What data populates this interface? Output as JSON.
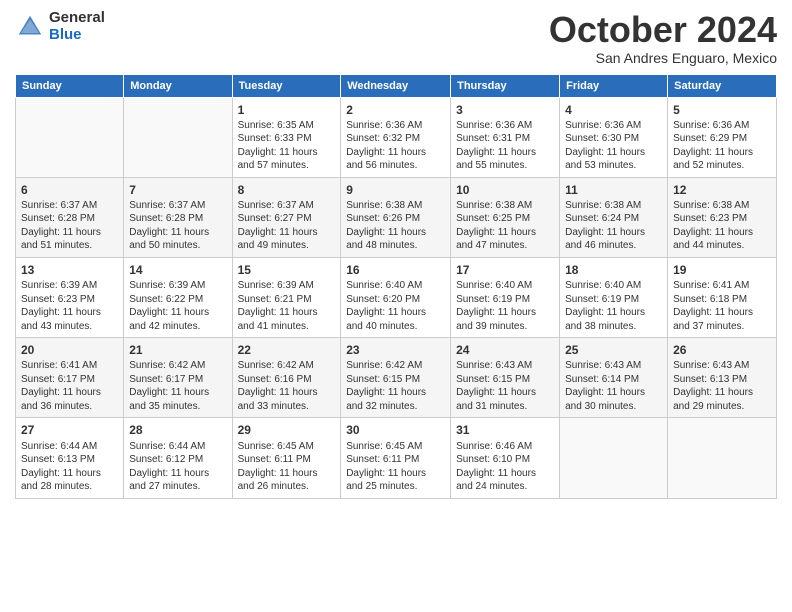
{
  "header": {
    "logo_general": "General",
    "logo_blue": "Blue",
    "month_title": "October 2024",
    "location": "San Andres Enguaro, Mexico"
  },
  "days_of_week": [
    "Sunday",
    "Monday",
    "Tuesday",
    "Wednesday",
    "Thursday",
    "Friday",
    "Saturday"
  ],
  "weeks": [
    [
      {
        "day": "",
        "info": ""
      },
      {
        "day": "",
        "info": ""
      },
      {
        "day": "1",
        "info": "Sunrise: 6:35 AM\nSunset: 6:33 PM\nDaylight: 11 hours and 57 minutes."
      },
      {
        "day": "2",
        "info": "Sunrise: 6:36 AM\nSunset: 6:32 PM\nDaylight: 11 hours and 56 minutes."
      },
      {
        "day": "3",
        "info": "Sunrise: 6:36 AM\nSunset: 6:31 PM\nDaylight: 11 hours and 55 minutes."
      },
      {
        "day": "4",
        "info": "Sunrise: 6:36 AM\nSunset: 6:30 PM\nDaylight: 11 hours and 53 minutes."
      },
      {
        "day": "5",
        "info": "Sunrise: 6:36 AM\nSunset: 6:29 PM\nDaylight: 11 hours and 52 minutes."
      }
    ],
    [
      {
        "day": "6",
        "info": "Sunrise: 6:37 AM\nSunset: 6:28 PM\nDaylight: 11 hours and 51 minutes."
      },
      {
        "day": "7",
        "info": "Sunrise: 6:37 AM\nSunset: 6:28 PM\nDaylight: 11 hours and 50 minutes."
      },
      {
        "day": "8",
        "info": "Sunrise: 6:37 AM\nSunset: 6:27 PM\nDaylight: 11 hours and 49 minutes."
      },
      {
        "day": "9",
        "info": "Sunrise: 6:38 AM\nSunset: 6:26 PM\nDaylight: 11 hours and 48 minutes."
      },
      {
        "day": "10",
        "info": "Sunrise: 6:38 AM\nSunset: 6:25 PM\nDaylight: 11 hours and 47 minutes."
      },
      {
        "day": "11",
        "info": "Sunrise: 6:38 AM\nSunset: 6:24 PM\nDaylight: 11 hours and 46 minutes."
      },
      {
        "day": "12",
        "info": "Sunrise: 6:38 AM\nSunset: 6:23 PM\nDaylight: 11 hours and 44 minutes."
      }
    ],
    [
      {
        "day": "13",
        "info": "Sunrise: 6:39 AM\nSunset: 6:23 PM\nDaylight: 11 hours and 43 minutes."
      },
      {
        "day": "14",
        "info": "Sunrise: 6:39 AM\nSunset: 6:22 PM\nDaylight: 11 hours and 42 minutes."
      },
      {
        "day": "15",
        "info": "Sunrise: 6:39 AM\nSunset: 6:21 PM\nDaylight: 11 hours and 41 minutes."
      },
      {
        "day": "16",
        "info": "Sunrise: 6:40 AM\nSunset: 6:20 PM\nDaylight: 11 hours and 40 minutes."
      },
      {
        "day": "17",
        "info": "Sunrise: 6:40 AM\nSunset: 6:19 PM\nDaylight: 11 hours and 39 minutes."
      },
      {
        "day": "18",
        "info": "Sunrise: 6:40 AM\nSunset: 6:19 PM\nDaylight: 11 hours and 38 minutes."
      },
      {
        "day": "19",
        "info": "Sunrise: 6:41 AM\nSunset: 6:18 PM\nDaylight: 11 hours and 37 minutes."
      }
    ],
    [
      {
        "day": "20",
        "info": "Sunrise: 6:41 AM\nSunset: 6:17 PM\nDaylight: 11 hours and 36 minutes."
      },
      {
        "day": "21",
        "info": "Sunrise: 6:42 AM\nSunset: 6:17 PM\nDaylight: 11 hours and 35 minutes."
      },
      {
        "day": "22",
        "info": "Sunrise: 6:42 AM\nSunset: 6:16 PM\nDaylight: 11 hours and 33 minutes."
      },
      {
        "day": "23",
        "info": "Sunrise: 6:42 AM\nSunset: 6:15 PM\nDaylight: 11 hours and 32 minutes."
      },
      {
        "day": "24",
        "info": "Sunrise: 6:43 AM\nSunset: 6:15 PM\nDaylight: 11 hours and 31 minutes."
      },
      {
        "day": "25",
        "info": "Sunrise: 6:43 AM\nSunset: 6:14 PM\nDaylight: 11 hours and 30 minutes."
      },
      {
        "day": "26",
        "info": "Sunrise: 6:43 AM\nSunset: 6:13 PM\nDaylight: 11 hours and 29 minutes."
      }
    ],
    [
      {
        "day": "27",
        "info": "Sunrise: 6:44 AM\nSunset: 6:13 PM\nDaylight: 11 hours and 28 minutes."
      },
      {
        "day": "28",
        "info": "Sunrise: 6:44 AM\nSunset: 6:12 PM\nDaylight: 11 hours and 27 minutes."
      },
      {
        "day": "29",
        "info": "Sunrise: 6:45 AM\nSunset: 6:11 PM\nDaylight: 11 hours and 26 minutes."
      },
      {
        "day": "30",
        "info": "Sunrise: 6:45 AM\nSunset: 6:11 PM\nDaylight: 11 hours and 25 minutes."
      },
      {
        "day": "31",
        "info": "Sunrise: 6:46 AM\nSunset: 6:10 PM\nDaylight: 11 hours and 24 minutes."
      },
      {
        "day": "",
        "info": ""
      },
      {
        "day": "",
        "info": ""
      }
    ]
  ]
}
